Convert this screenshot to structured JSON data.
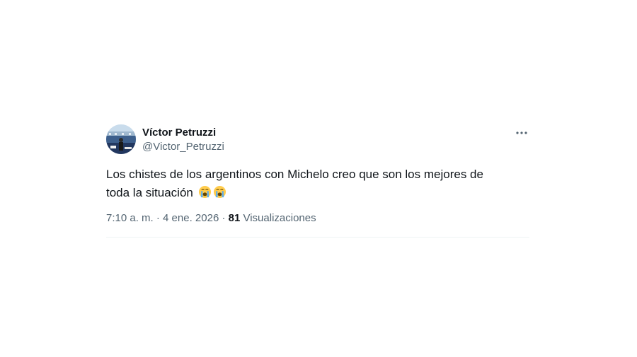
{
  "author": {
    "display_name": "Víctor Petruzzi",
    "handle": "@Victor_Petruzzi"
  },
  "more_icon": "more-horizontal-icon",
  "tweet": {
    "text_line1": "Los chistes de los argentinos con Michelo creo que son los mejores de",
    "text_line2": "toda la situación",
    "emojis": [
      "loudly-crying-face",
      "loudly-crying-face"
    ]
  },
  "meta": {
    "time": "7:10 a. m.",
    "separator1": " · ",
    "date": "4 ene. 2026",
    "separator2": " · ",
    "views_count": "81",
    "views_label": " Visualizaciones"
  },
  "colors": {
    "text": "#0f1419",
    "secondary": "#536471",
    "divider": "#eff3f4"
  }
}
